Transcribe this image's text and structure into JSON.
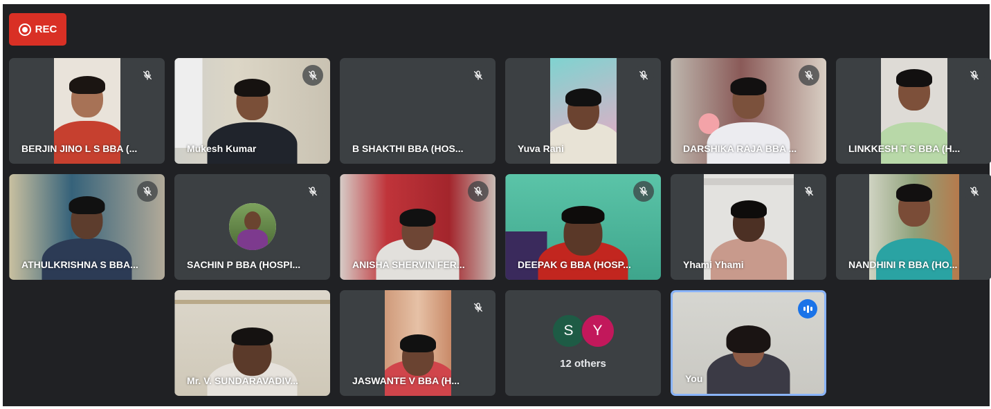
{
  "recording": {
    "label": "REC",
    "color": "#d93025"
  },
  "participants": [
    {
      "name": "BERJIN JINO L S BBA (...",
      "muted": true
    },
    {
      "name": "Mukesh Kumar",
      "muted": true
    },
    {
      "name": "B SHAKTHI BBA (HOS...",
      "muted": true
    },
    {
      "name": "Yuva Rani",
      "muted": true
    },
    {
      "name": "DARSHIKA RAJA BBA ...",
      "muted": true
    },
    {
      "name": "LINKKESH T S BBA (H...",
      "muted": true
    },
    {
      "name": "ATHULKRISHNA S BBA...",
      "muted": true
    },
    {
      "name": "SACHIN P BBA (HOSPI...",
      "muted": true
    },
    {
      "name": "ANISHA SHERVIN FER...",
      "muted": true
    },
    {
      "name": "DEEPAK G BBA (HOSP...",
      "muted": true
    },
    {
      "name": "Yhami Yhami",
      "muted": true
    },
    {
      "name": "NANDHINI R BBA (HO...",
      "muted": true
    },
    {
      "name": "Mr. V. SUNDARAVADIV...",
      "muted": false
    },
    {
      "name": "JASWANTE V BBA (H...",
      "muted": true
    }
  ],
  "others": {
    "initials": [
      "S",
      "Y"
    ],
    "colors": [
      "#1e5b45",
      "#c2185b"
    ],
    "label": "12 others"
  },
  "self": {
    "name": "You",
    "speaking": true,
    "highlight_color": "#8ab4f8"
  },
  "icons": {
    "mute": "mic-off-icon",
    "speaking": "audio-level-icon",
    "record": "record-icon"
  }
}
